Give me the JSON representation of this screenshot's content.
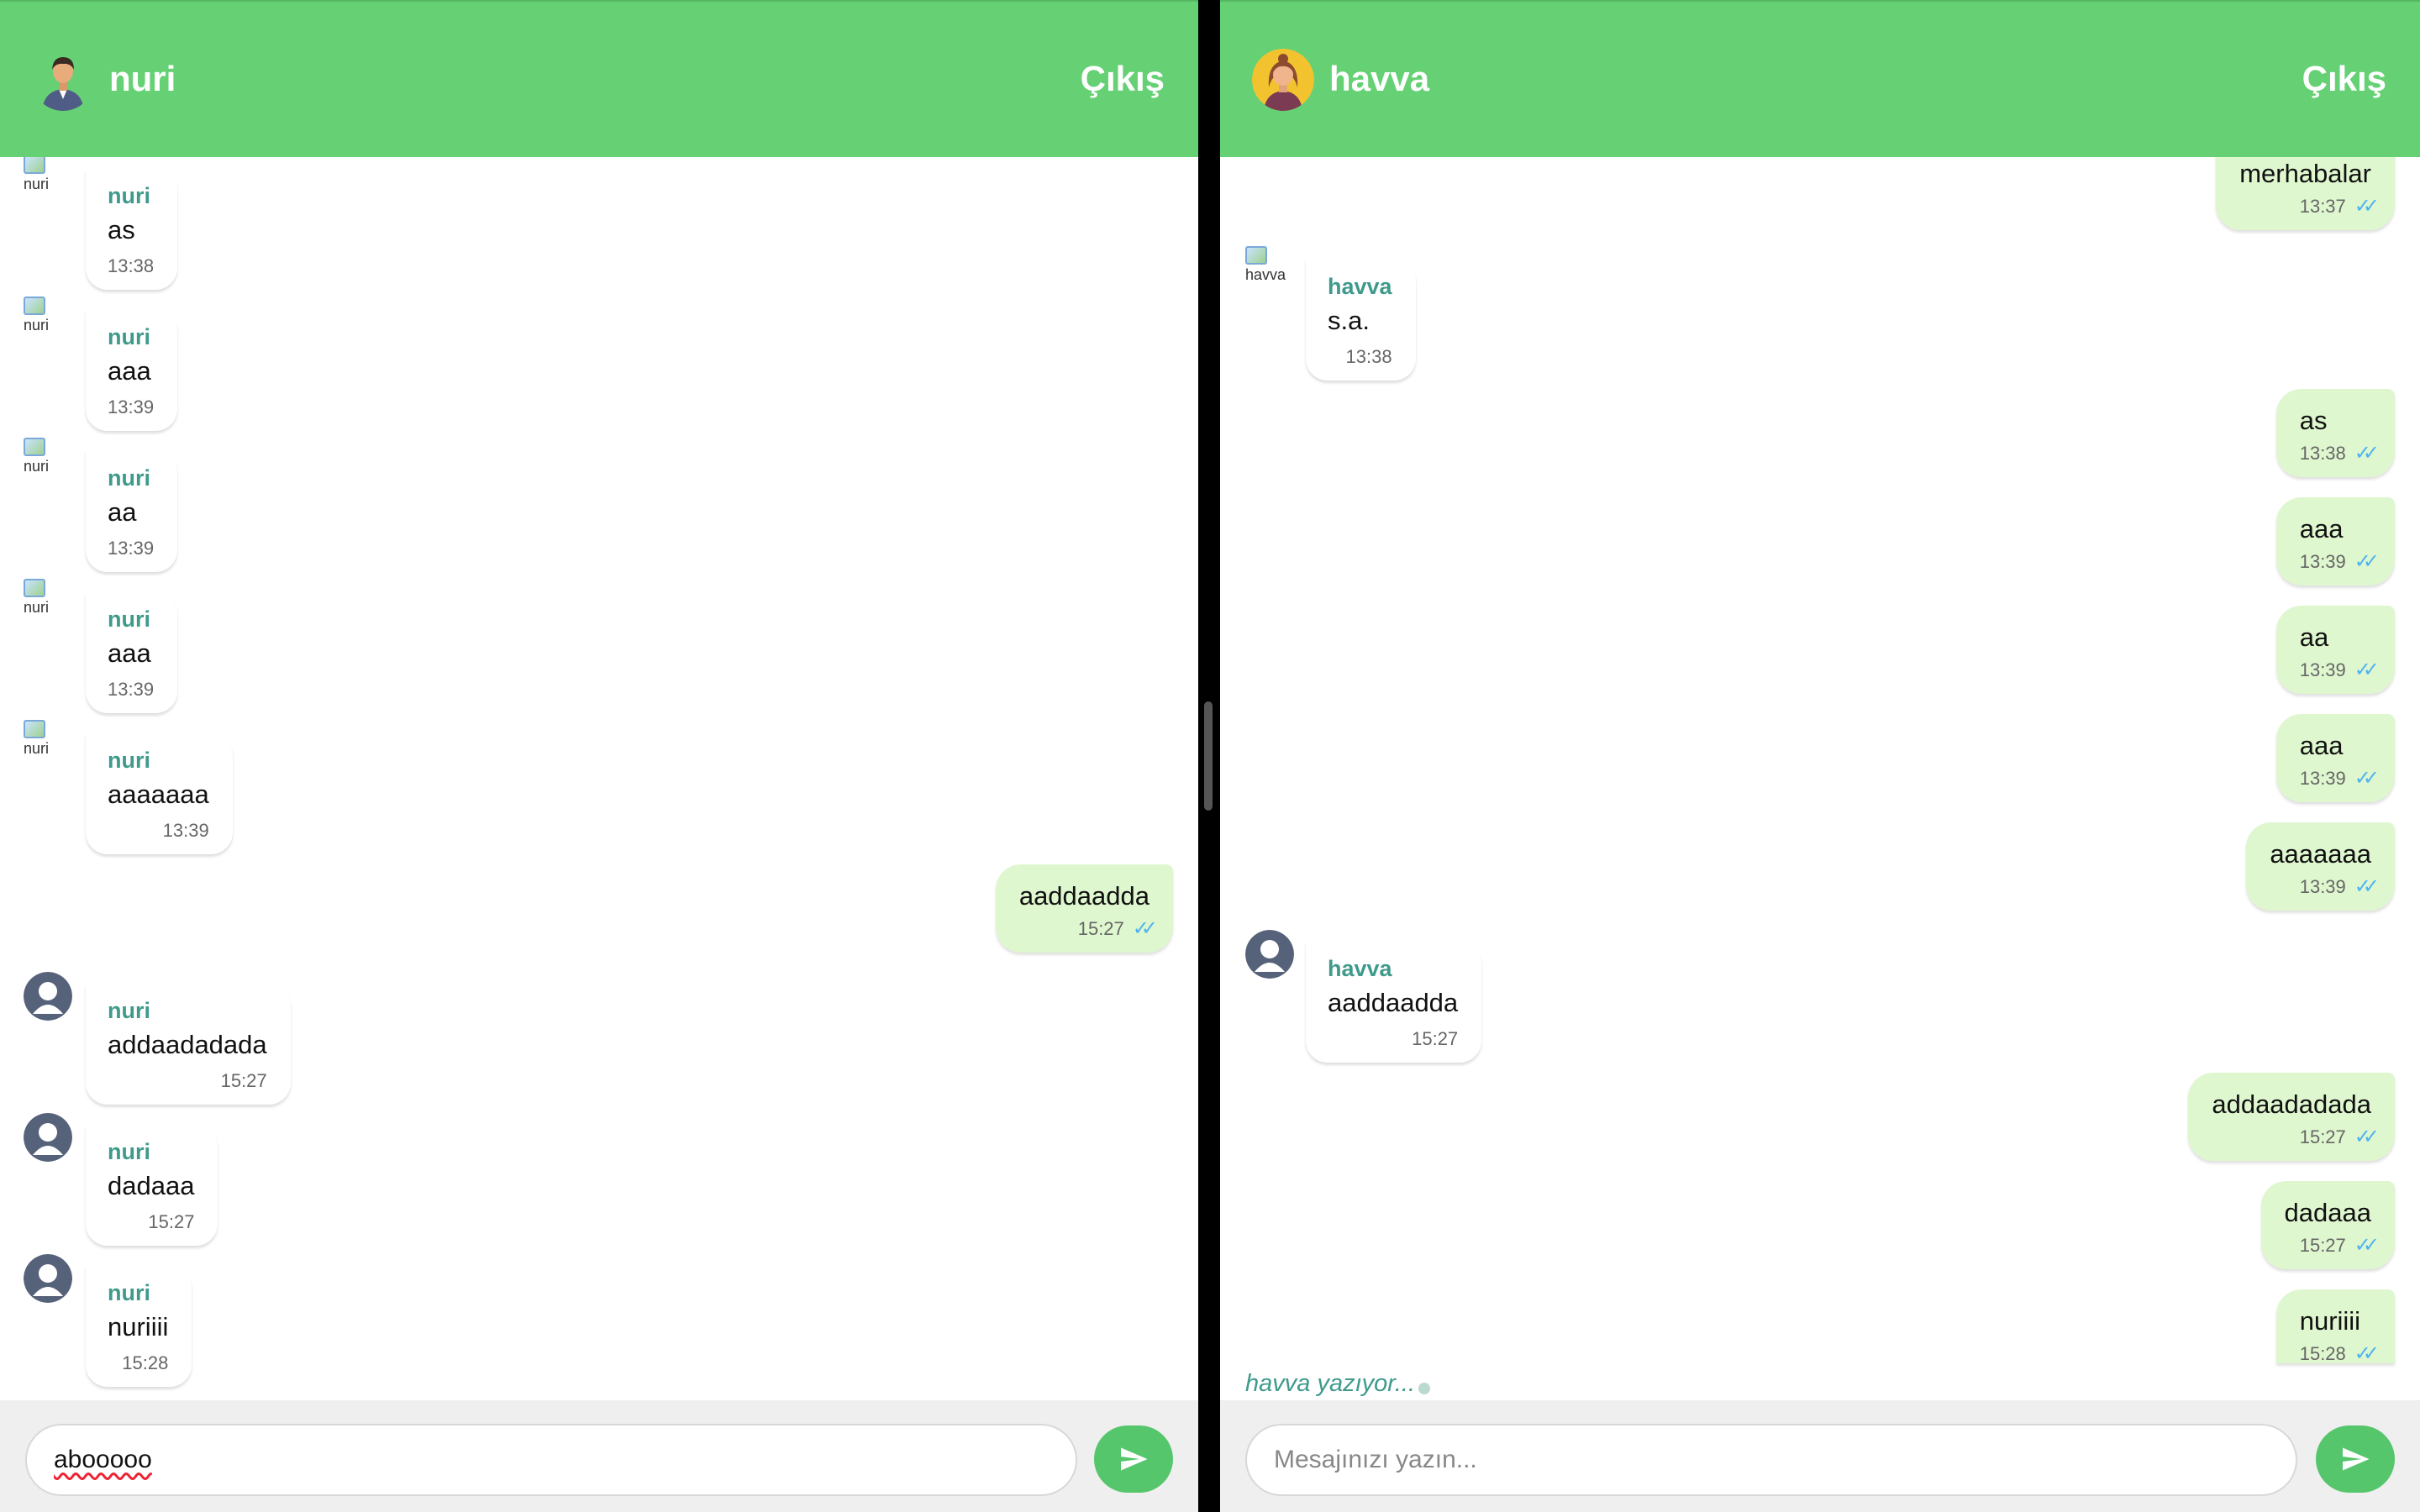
{
  "left": {
    "header": {
      "username": "nuri",
      "logout_label": "Çıkış"
    },
    "messages": [
      {
        "sender": "nuri",
        "text": "as",
        "time": "13:38",
        "avatar_broken_text": "nuri"
      },
      {
        "sender": "nuri",
        "text": "aaa",
        "time": "13:39",
        "avatar_broken_text": "nuri"
      },
      {
        "sender": "nuri",
        "text": "aa",
        "time": "13:39",
        "avatar_broken_text": "nuri"
      },
      {
        "sender": "nuri",
        "text": "aaa",
        "time": "13:39",
        "avatar_broken_text": "nuri"
      },
      {
        "sender": "nuri",
        "text": "aaaaaaa",
        "time": "13:39",
        "avatar_broken_text": "nuri"
      },
      {
        "text": "aaddaadda",
        "time": "15:27",
        "status_icon": "double-check-icon"
      },
      {
        "sender": "nuri",
        "text": "addaadadada",
        "time": "15:27",
        "avatar_icon": "default-user-icon"
      },
      {
        "sender": "nuri",
        "text": "dadaaa",
        "time": "15:27",
        "avatar_icon": "default-user-icon"
      },
      {
        "sender": "nuri",
        "text": "nuriiii",
        "time": "15:28",
        "avatar_icon": "default-user-icon"
      }
    ],
    "input": {
      "value": "abooooo",
      "placeholder": "Mesajınızı yazın..."
    },
    "send_icon": "send-icon"
  },
  "right": {
    "header": {
      "username": "havva",
      "logout_label": "Çıkış"
    },
    "messages": [
      {
        "text": "merhabalar",
        "time": "13:37",
        "status_icon": "double-check-icon"
      },
      {
        "sender": "havva",
        "text": "s.a.",
        "time": "13:38",
        "avatar_broken_text": "havva"
      },
      {
        "text": "as",
        "time": "13:38",
        "status_icon": "double-check-icon"
      },
      {
        "text": "aaa",
        "time": "13:39",
        "status_icon": "double-check-icon"
      },
      {
        "text": "aa",
        "time": "13:39",
        "status_icon": "double-check-icon"
      },
      {
        "text": "aaa",
        "time": "13:39",
        "status_icon": "double-check-icon"
      },
      {
        "text": "aaaaaaa",
        "time": "13:39",
        "status_icon": "double-check-icon"
      },
      {
        "sender": "havva",
        "text": "aaddaadda",
        "time": "15:27",
        "avatar_icon": "default-user-icon"
      },
      {
        "text": "addaadadada",
        "time": "15:27",
        "status_icon": "double-check-icon"
      },
      {
        "text": "dadaaa",
        "time": "15:27",
        "status_icon": "double-check-icon"
      },
      {
        "text": "nuriiii",
        "time": "15:28",
        "status_icon": "double-check-icon"
      }
    ],
    "typing_indicator": "havva yazıyor...",
    "input": {
      "value": "",
      "placeholder": "Mesajınızı yazın..."
    },
    "send_icon": "send-icon"
  },
  "colors": {
    "header": "#66d174",
    "outgoing_bubble": "#dff7cf",
    "sender_name": "#3f9a8c",
    "read_ticks": "#4fb3f0",
    "send_button": "#56c66c"
  }
}
